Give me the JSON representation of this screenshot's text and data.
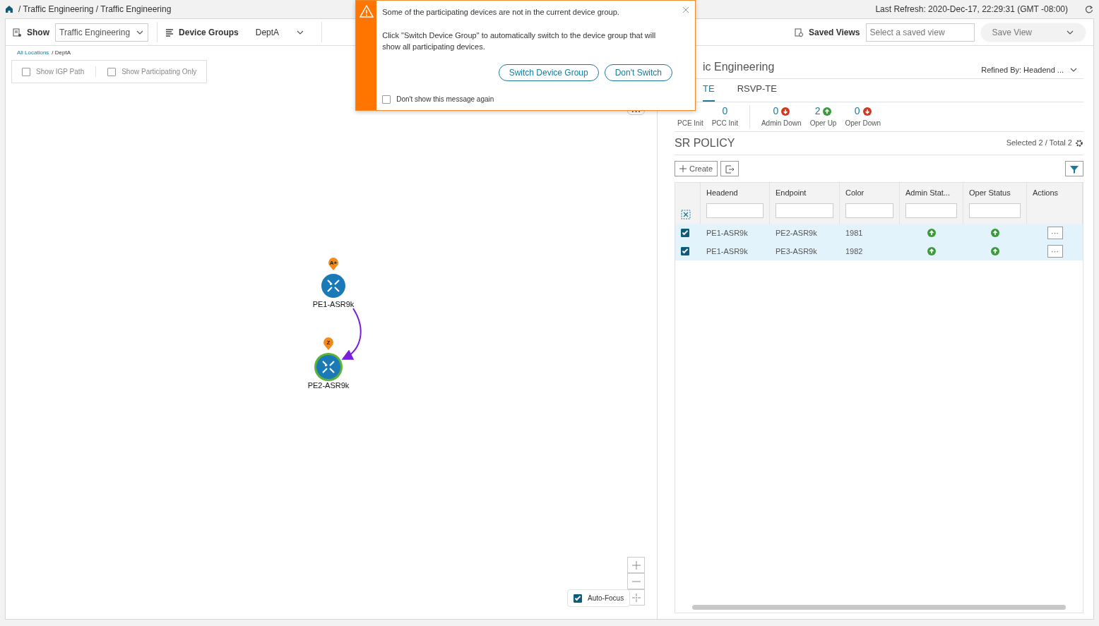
{
  "breadcrumb": [
    "/ Traffic Engineering / Traffic Engineering"
  ],
  "map_menu": "···",
  "last_refresh": "Last Refresh: 2020-Dec-17, 22:29:31 (GMT -08:00)",
  "toolbar": {
    "show_label": "Show",
    "show_value": "Traffic Engineering",
    "groups_label": "Device Groups",
    "groups_value": "DeptA",
    "saved_views_label": "Saved Views",
    "saved_view_placeholder": "Select a saved view",
    "save_view": "Save View"
  },
  "location": {
    "link": "All Locations",
    "current": "/ DeptA"
  },
  "map_options": [
    {
      "label": "Show IGP Path",
      "checked": false
    },
    {
      "label": "Show Participating Only",
      "checked": false
    }
  ],
  "nodes": [
    {
      "name": "PE1-ASR9k",
      "marker": "A+",
      "highlighted": false
    },
    {
      "name": "PE2-ASR9k",
      "marker": "Z",
      "highlighted": true
    }
  ],
  "auto_focus": {
    "label": "Auto-Focus",
    "checked": true
  },
  "alert": {
    "message": "Some of the participating devices are not in the current device group.",
    "detail": "Click \"Switch Device Group\" to automatically switch to the device group that will show all participating devices.",
    "buttons": [
      "Switch Device Group",
      "Don't Switch"
    ],
    "dont_show": {
      "label": "Don't show this message again",
      "checked": false
    }
  },
  "panel": {
    "title": "ic Engineering",
    "refined_by": "Refined By: Headend ...",
    "tabs": [
      {
        "label": "TE",
        "selected": true
      },
      {
        "label": "RSVP-TE",
        "selected": false
      }
    ],
    "stats": [
      {
        "label": "PCE Init"
      },
      {
        "value": "0",
        "label": "PCC Init"
      },
      {
        "value": "0",
        "label": "Admin Down",
        "kind": "down"
      },
      {
        "value": "2",
        "label": "Oper Up",
        "kind": "up"
      },
      {
        "value": "0",
        "label": "Oper Down",
        "kind": "down"
      }
    ],
    "section": "SR POLICY",
    "selection": "Selected 2 / Total 2",
    "create": "Create",
    "table": {
      "columns": [
        "Headend",
        "Endpoint",
        "Color",
        "Admin Stat...",
        "Oper Status",
        "Actions"
      ],
      "rows": [
        {
          "selected": true,
          "headend": "PE1-ASR9k",
          "endpoint": "PE2-ASR9k",
          "policy_color": "1981",
          "admin_up": true,
          "oper_up": true,
          "actions": "···"
        },
        {
          "selected": true,
          "headend": "PE1-ASR9k",
          "endpoint": "PE3-ASR9k",
          "policy_color": "1982",
          "admin_up": true,
          "oper_up": true,
          "actions": "···"
        }
      ]
    }
  }
}
